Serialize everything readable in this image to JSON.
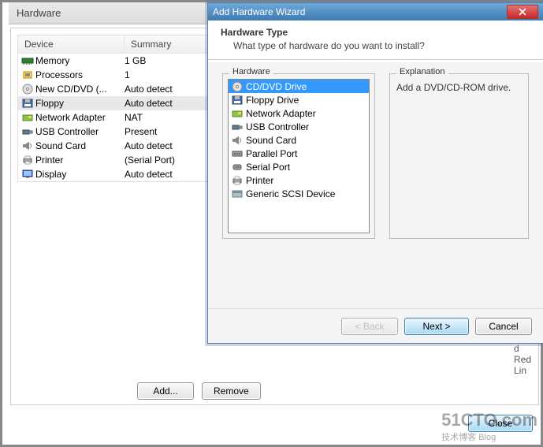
{
  "back": {
    "title": "Hardware",
    "columns": {
      "device": "Device",
      "summary": "Summary"
    },
    "rows": [
      {
        "icon": "memory",
        "name": "Memory",
        "summary": "1 GB",
        "selected": false
      },
      {
        "icon": "cpu",
        "name": "Processors",
        "summary": "1",
        "selected": false
      },
      {
        "icon": "cd",
        "name": "New CD/DVD (...",
        "summary": "Auto detect",
        "selected": false
      },
      {
        "icon": "floppy",
        "name": "Floppy",
        "summary": "Auto detect",
        "selected": true
      },
      {
        "icon": "nic",
        "name": "Network Adapter",
        "summary": "NAT",
        "selected": false
      },
      {
        "icon": "usb",
        "name": "USB Controller",
        "summary": "Present",
        "selected": false
      },
      {
        "icon": "sound",
        "name": "Sound Card",
        "summary": "Auto detect",
        "selected": false
      },
      {
        "icon": "printer",
        "name": "Printer",
        "summary": "(Serial Port)",
        "selected": false
      },
      {
        "icon": "display",
        "name": "Display",
        "summary": "Auto detect",
        "selected": false
      }
    ],
    "buttons": {
      "add": "Add...",
      "remove": "Remove",
      "close": "Close"
    }
  },
  "wizard": {
    "window_title": "Add Hardware Wizard",
    "header_title": "Hardware Type",
    "header_sub": "What type of hardware do you want to install?",
    "hw_label": "Hardware",
    "expl_label": "Explanation",
    "expl_text": "Add a DVD/CD-ROM drive.",
    "items": [
      {
        "icon": "cd",
        "label": "CD/DVD Drive",
        "selected": true
      },
      {
        "icon": "floppy",
        "label": "Floppy Drive",
        "selected": false
      },
      {
        "icon": "nic",
        "label": "Network Adapter",
        "selected": false
      },
      {
        "icon": "usb",
        "label": "USB Controller",
        "selected": false
      },
      {
        "icon": "sound",
        "label": "Sound Card",
        "selected": false
      },
      {
        "icon": "parallel",
        "label": "Parallel Port",
        "selected": false
      },
      {
        "icon": "serial",
        "label": "Serial Port",
        "selected": false
      },
      {
        "icon": "printer",
        "label": "Printer",
        "selected": false
      },
      {
        "icon": "scsi",
        "label": "Generic SCSI Device",
        "selected": false
      }
    ],
    "buttons": {
      "back": "< Back",
      "next": "Next >",
      "cancel": "Cancel"
    }
  },
  "right_fragment": [
    "d",
    "Red",
    "Lin"
  ],
  "watermark": {
    "big": "51CTO.com",
    "small": "技术博客    Blog"
  }
}
